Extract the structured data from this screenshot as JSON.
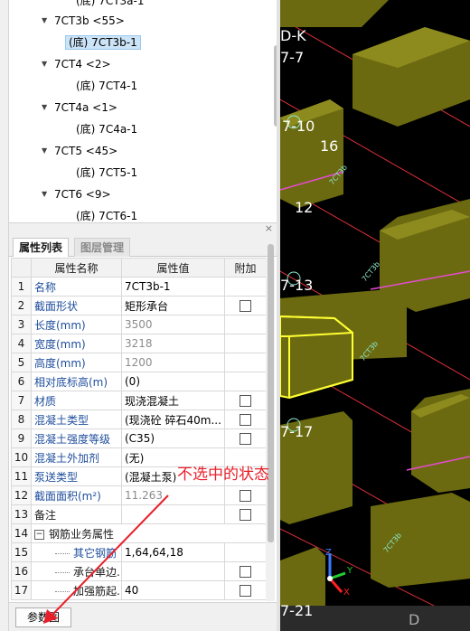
{
  "tree": {
    "items": [
      {
        "label": "(底) 7CT3a-1",
        "expandable": false
      },
      {
        "label": "7CT3b <55>",
        "expandable": true
      },
      {
        "label": "(底) 7CT3b-1",
        "expandable": false,
        "selected": true
      },
      {
        "label": "7CT4 <2>",
        "expandable": true
      },
      {
        "label": "(底) 7CT4-1",
        "expandable": false
      },
      {
        "label": "7CT4a <1>",
        "expandable": true
      },
      {
        "label": "(底) 7C4a-1",
        "expandable": false
      },
      {
        "label": "7CT5 <45>",
        "expandable": true
      },
      {
        "label": "(底) 7CT5-1",
        "expandable": false
      },
      {
        "label": "7CT6 <9>",
        "expandable": true
      },
      {
        "label": "(底) 7CT6-1",
        "expandable": false
      }
    ]
  },
  "panel": {
    "close_icon": "×"
  },
  "tabs": [
    {
      "label": "属性列表",
      "active": true
    },
    {
      "label": "图层管理",
      "active": false
    }
  ],
  "table": {
    "headers": [
      "属性名称",
      "属性值",
      "附加"
    ],
    "rows": [
      {
        "num": "1",
        "name": "名称",
        "value": "7CT3b-1",
        "checkbox": false
      },
      {
        "num": "2",
        "name": "截面形状",
        "value": "矩形承台",
        "checkbox": true
      },
      {
        "num": "3",
        "name": "长度(mm)",
        "value": "3500",
        "checkbox": false
      },
      {
        "num": "4",
        "name": "宽度(mm)",
        "value": "3218",
        "checkbox": false
      },
      {
        "num": "5",
        "name": "高度(mm)",
        "value": "1200",
        "checkbox": false
      },
      {
        "num": "6",
        "name": "相对底标高(m)",
        "value": "(0)",
        "checkbox": false
      },
      {
        "num": "7",
        "name": "材质",
        "value": "现浇混凝土",
        "checkbox": true
      },
      {
        "num": "8",
        "name": "混凝土类型",
        "value": "(现浇砼 碎石40m...",
        "checkbox": true
      },
      {
        "num": "9",
        "name": "混凝土强度等级",
        "value": "(C35)",
        "checkbox": true
      },
      {
        "num": "10",
        "name": "混凝土外加剂",
        "value": "(无)",
        "checkbox": false
      },
      {
        "num": "11",
        "name": "泵送类型",
        "value": "(混凝土泵)",
        "checkbox": false
      },
      {
        "num": "12",
        "name": "截面面积(m²)",
        "value": "11.263",
        "checkbox": true
      },
      {
        "num": "13",
        "name": "备注",
        "value": "",
        "checkbox": true
      },
      {
        "num": "14",
        "name": "钢筋业务属性",
        "value": "",
        "checkbox": false
      },
      {
        "num": "15",
        "name": "其它钢筋",
        "value": "1,64,64,18",
        "checkbox": false
      },
      {
        "num": "16",
        "name": "承台单边...",
        "value": "",
        "checkbox": true
      },
      {
        "num": "17",
        "name": "加强筋起...",
        "value": "40",
        "checkbox": true
      }
    ]
  },
  "bottom": {
    "param_button": "参数图"
  },
  "annotation": {
    "text": "不选中的状态",
    "color": "#e8202a"
  },
  "viewport": {
    "labels": [
      "D-K",
      "7-7",
      "7-10",
      "16",
      "12",
      "7-13",
      "7-17",
      "7-21",
      "D"
    ],
    "axes": {
      "x": "X",
      "y": "Y",
      "z": "Z"
    },
    "colors": {
      "cap": "#6b6a10",
      "cap_top": "#8d8b1e",
      "selected": "#ffff33",
      "gridline": "#e0303a",
      "axis_label": "#8ee8cc"
    }
  }
}
